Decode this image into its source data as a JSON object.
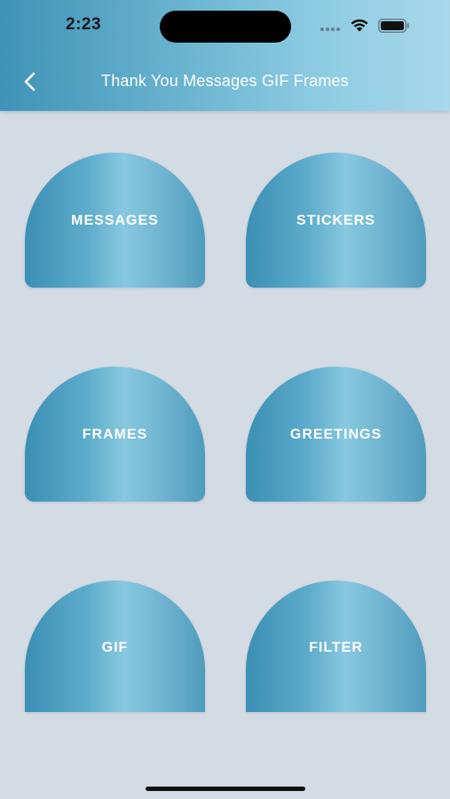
{
  "status_bar": {
    "time": "2:23"
  },
  "header": {
    "title": "Thank You Messages GIF Frames",
    "gradient": [
      "#3f93b6",
      "#a9d8ea"
    ]
  },
  "tiles": [
    {
      "label": "MESSAGES"
    },
    {
      "label": "STICKERS"
    },
    {
      "label": "FRAMES"
    },
    {
      "label": "GREETINGS"
    },
    {
      "label": "GIF"
    },
    {
      "label": "FILTER"
    }
  ],
  "colors": {
    "background": "#d3dce4",
    "tile_accent": "#5eaccc",
    "text": "#ffffff"
  }
}
